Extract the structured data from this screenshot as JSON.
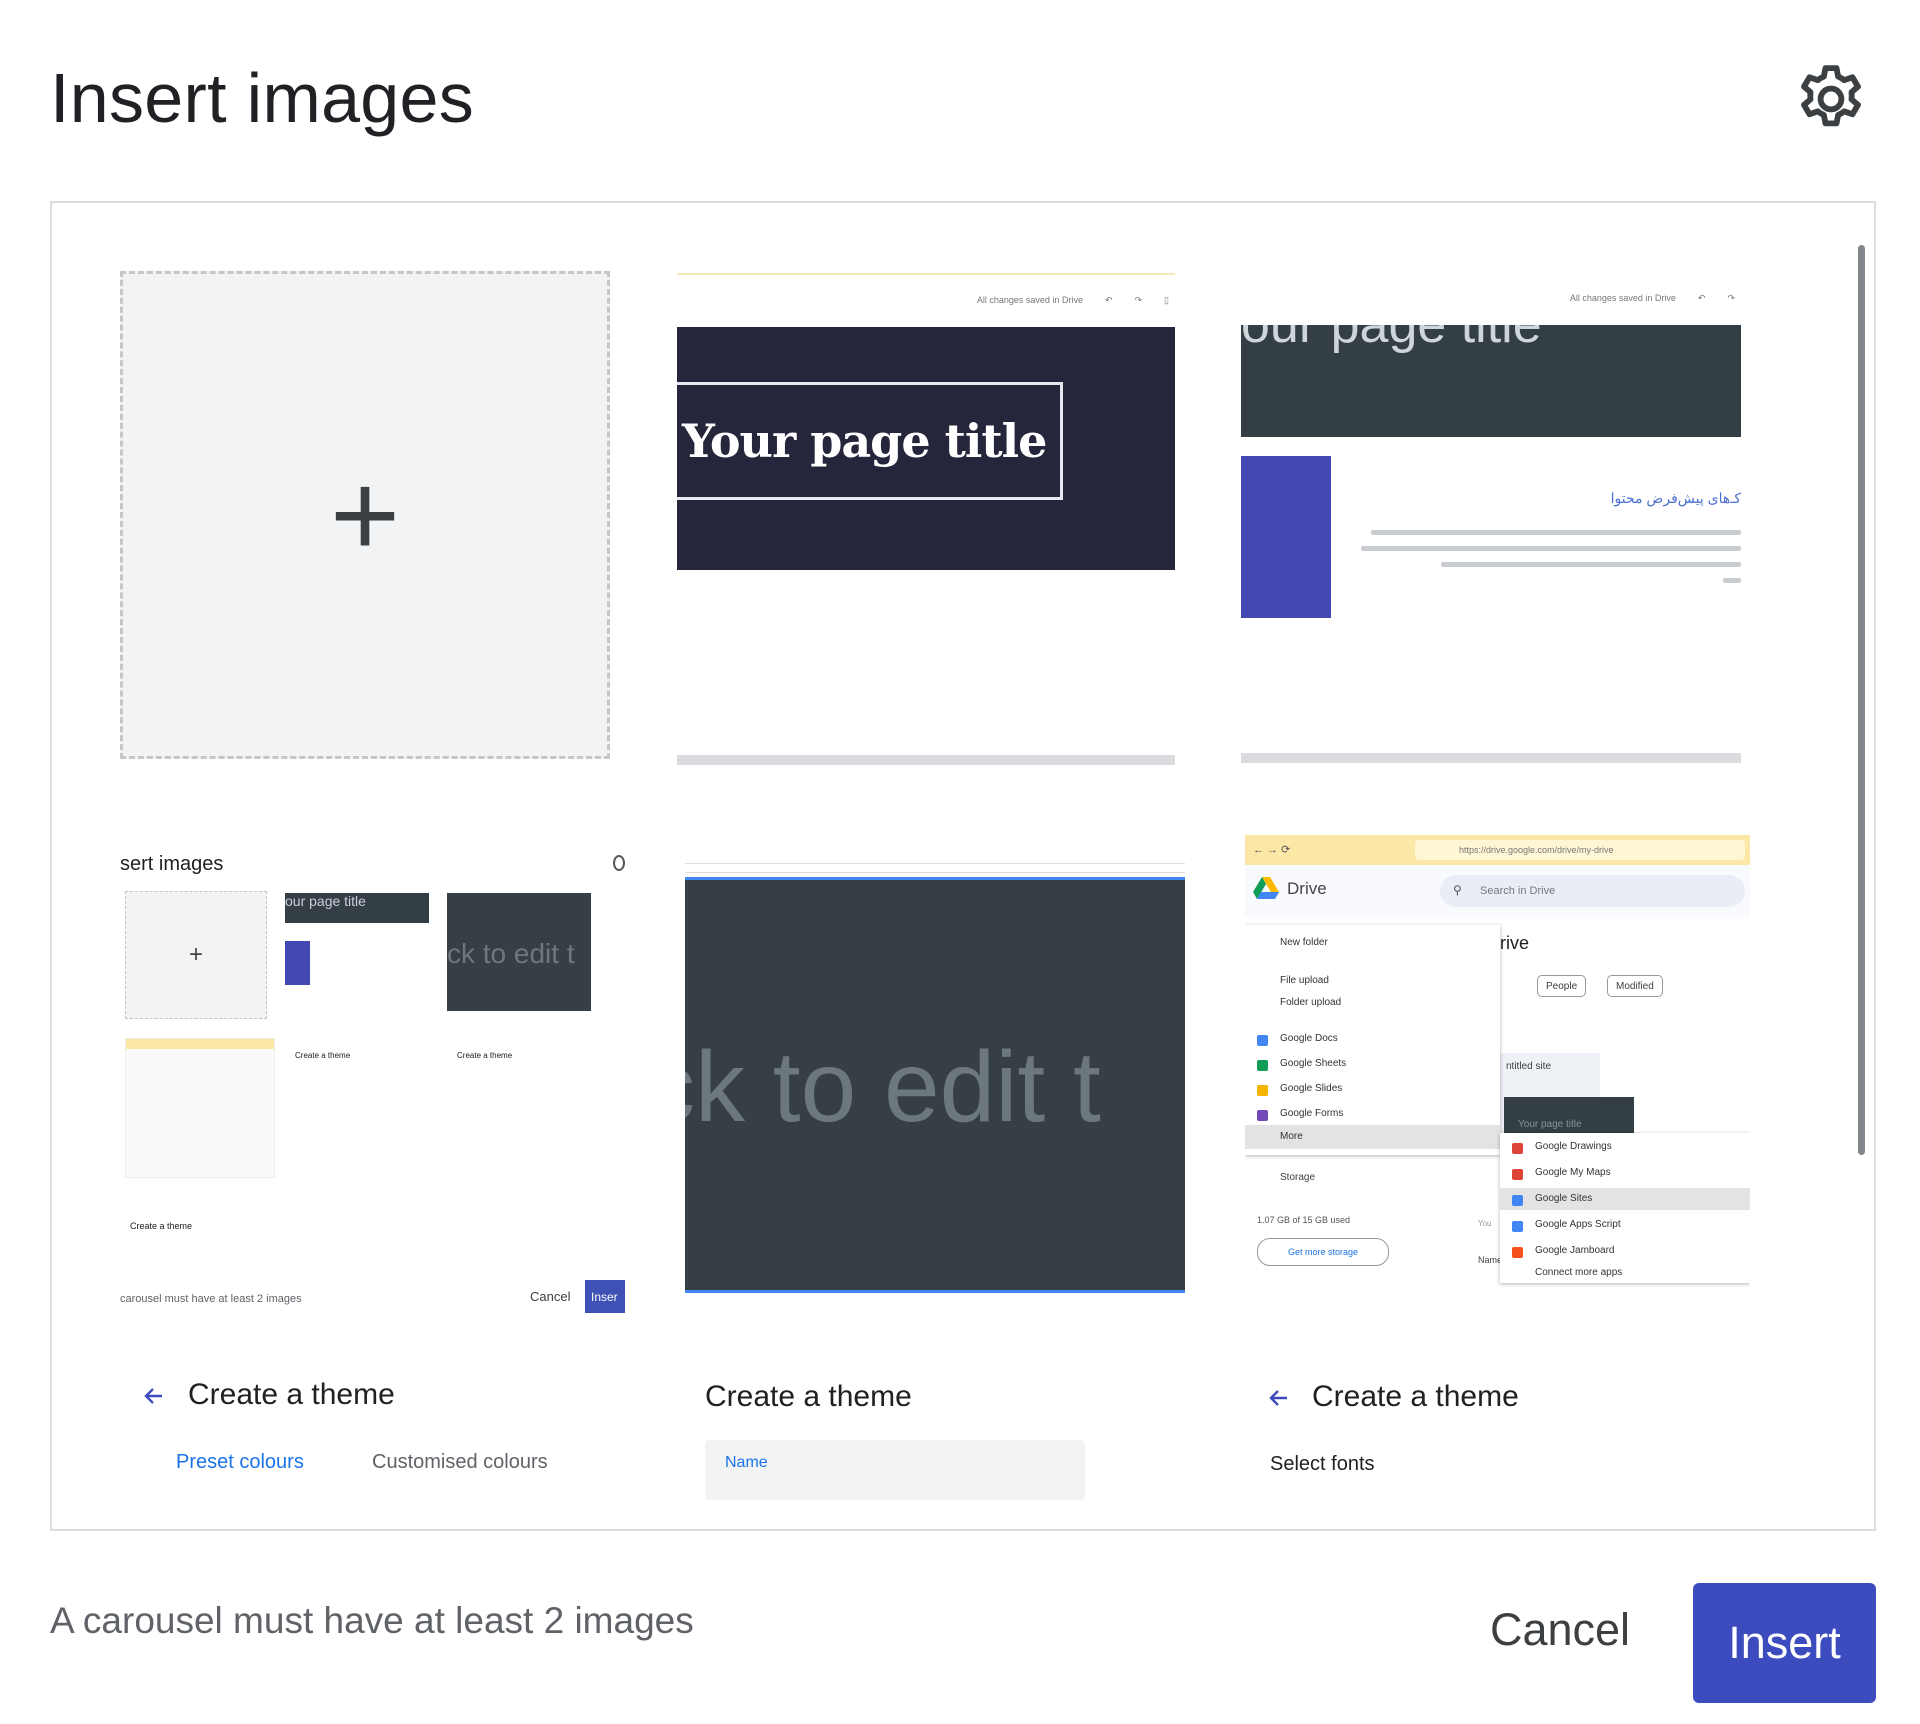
{
  "dialog": {
    "title": "Insert images",
    "settings_icon": "gear-icon"
  },
  "add_tile": {
    "icon": "plus-icon",
    "glyph": "+"
  },
  "thumbnails": {
    "page_title": {
      "status": "All changes saved in Drive",
      "banner_title": "Your page title"
    },
    "page_title_rtl": {
      "status": "All changes saved in Drive",
      "banner_fragment": "our page title",
      "rtl_heading": "کـ‌های پیش‌فرض محتوا"
    },
    "mini_dialog": {
      "title": "sert images",
      "add_glyph": "+",
      "tile1_text": "our page title",
      "tile2_text": "ck to edit t",
      "tile4_title": "Create a theme",
      "tile5_title": "Create a theme",
      "theme_title": "Create a theme",
      "message": "carousel must have at least 2 images",
      "cancel": "Cancel",
      "insert": "Inser"
    },
    "click_to_edit": {
      "text": "ck to edit t"
    },
    "drive": {
      "url": "https://drive.google.com/drive/my-drive",
      "app_name": "Drive",
      "search_placeholder": "Search in Drive",
      "menu_items": [
        "New folder",
        "File upload",
        "Folder upload",
        "Google Docs",
        "Google Sheets",
        "Google Slides",
        "Google Forms",
        "More"
      ],
      "storage_label": "Storage",
      "storage_used": "1.07 GB of 15 GB used",
      "get_storage": "Get more storage",
      "drive_fragment": "rive",
      "chips": [
        "People",
        "Modified"
      ],
      "site_name": "ntitled site",
      "site_thumb_text": "Your page title",
      "name_col": "Name",
      "you_text": "You",
      "submenu_items": [
        "Google Drawings",
        "Google My Maps",
        "Google Sites",
        "Google Apps Script",
        "Google Jamboard",
        "Connect more apps"
      ]
    }
  },
  "partial_tiles": [
    {
      "heading": "Create a theme",
      "tab_active": "Preset colours",
      "tab_other": "Customised colours"
    },
    {
      "heading": "Create a theme",
      "field_label": "Name"
    },
    {
      "heading": "Create a theme",
      "subheading": "Select fonts"
    }
  ],
  "footer": {
    "message": "A carousel must have at least 2 images",
    "cancel_label": "Cancel",
    "insert_label": "Insert"
  },
  "colors": {
    "accent": "#3c4bbd",
    "link_blue": "#1a73e8",
    "banner_navy": "#25253c",
    "banner_slate": "#353f44",
    "tile_grey": "#f1f3f4"
  }
}
